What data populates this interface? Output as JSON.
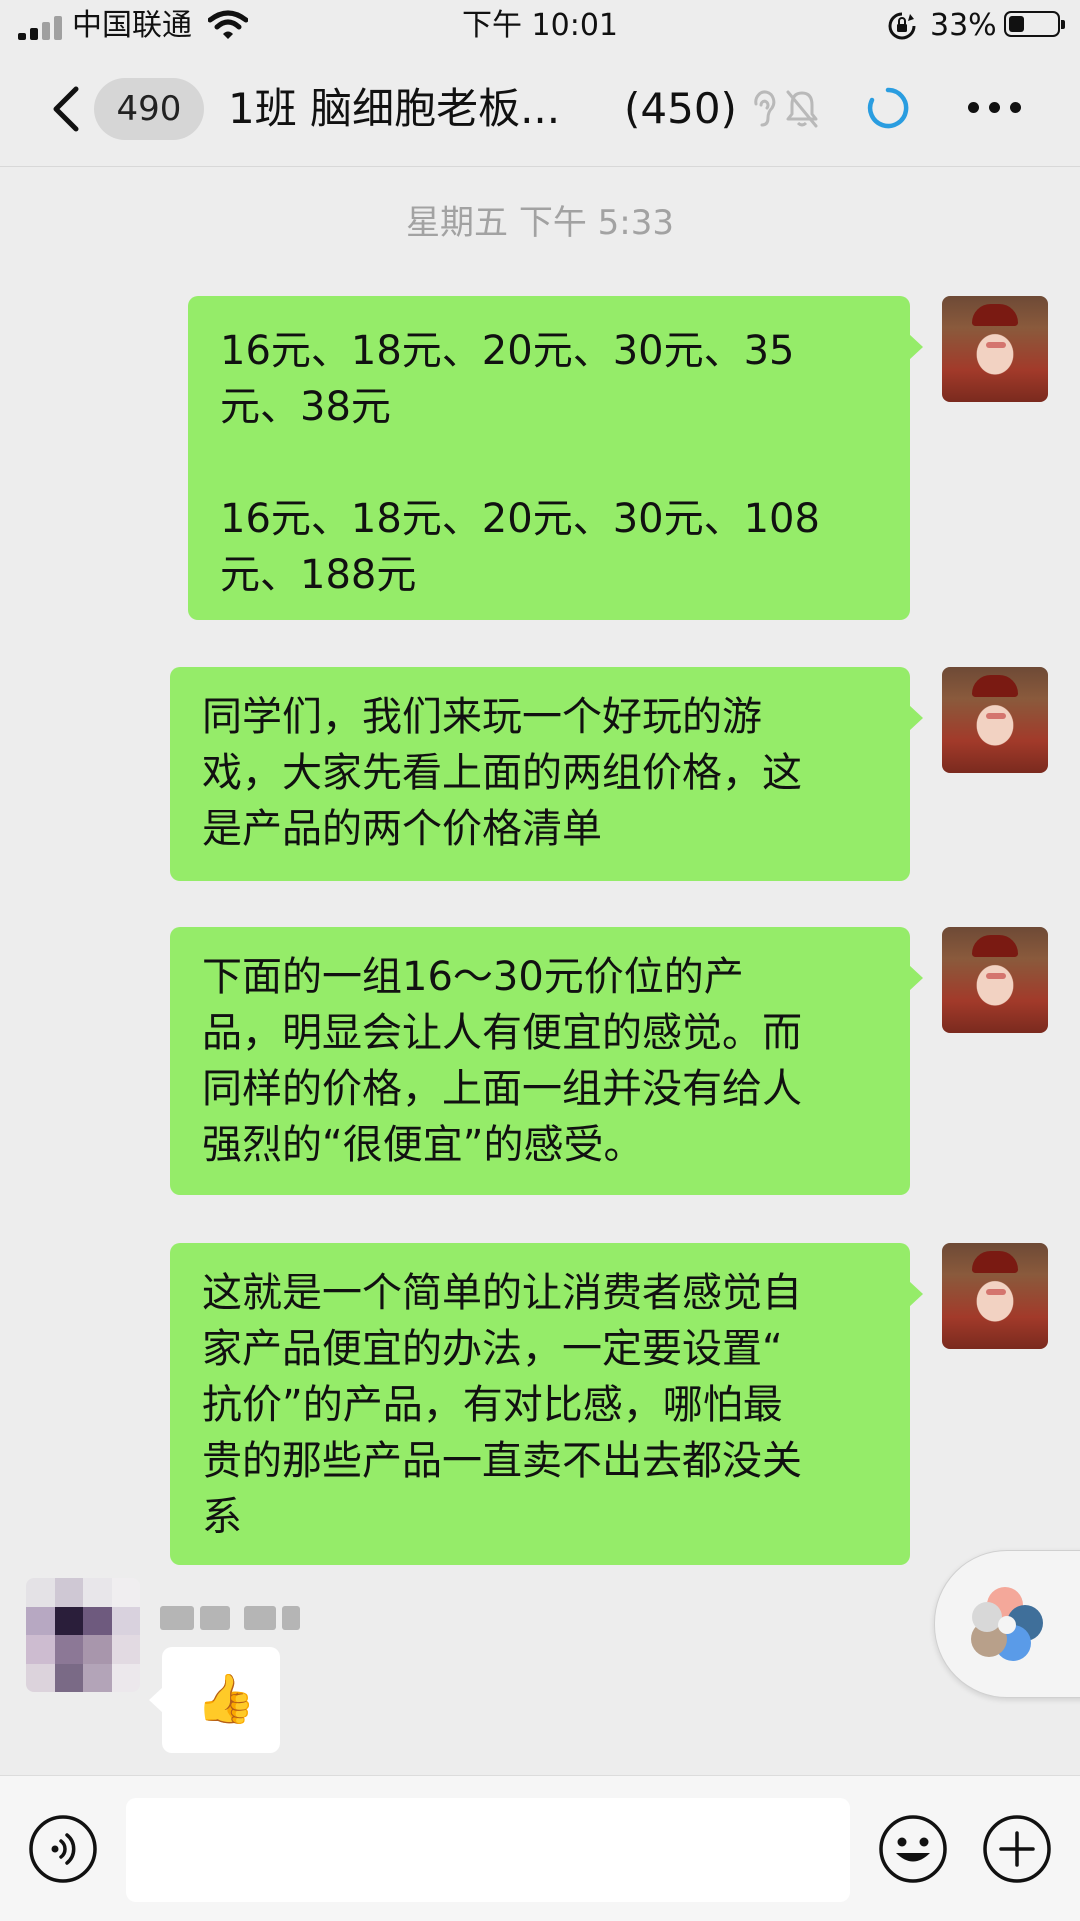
{
  "status_bar": {
    "carrier": "中国联通",
    "time": "下午 10:01",
    "battery_percent": "33%",
    "battery_level": 0.33,
    "icons": [
      "signal-icon",
      "wifi-icon",
      "rotation-lock-icon",
      "battery-icon"
    ]
  },
  "nav": {
    "unread_count": "490",
    "title": "1班 脑细胞老板...",
    "member_count": "(450)",
    "icons": [
      "back-icon",
      "ear-icon",
      "mute-bell-icon",
      "loading-icon",
      "more-icon"
    ]
  },
  "chat": {
    "timestamp": "星期五 下午 5:33",
    "messages": [
      {
        "sender": "me",
        "text": "16元、18元、20元、30元、35\n元、38元\n\n16元、18元、20元、30元、108\n元、188元"
      },
      {
        "sender": "me",
        "text": "同学们，我们来玩一个好玩的游\n戏，大家先看上面的两组价格，这\n是产品的两个价格清单"
      },
      {
        "sender": "me",
        "text": "下面的一组16～30元价位的产\n品，明显会让人有便宜的感觉。而\n同样的价格，上面一组并没有给人\n强烈的“很便宜”的感受。"
      },
      {
        "sender": "me",
        "text": "这就是一个简单的让消费者感觉自\n家产品便宜的办法，一定要设置“\n抗价”的产品，有对比感，哪怕最\n贵的那些产品一直卖不出去都没关\n系"
      },
      {
        "sender": "other",
        "emoji": "👍",
        "emoji_name": "thumbs-up"
      }
    ]
  },
  "input_bar": {
    "placeholder": "",
    "icons": [
      "voice-icon",
      "emoji-icon",
      "plus-icon"
    ]
  },
  "colors": {
    "background": "#ededed",
    "bubble_me": "#95ec69",
    "bubble_other": "#ffffff",
    "timestamp": "#a2a2a2",
    "loading_accent": "#2a9de0"
  }
}
